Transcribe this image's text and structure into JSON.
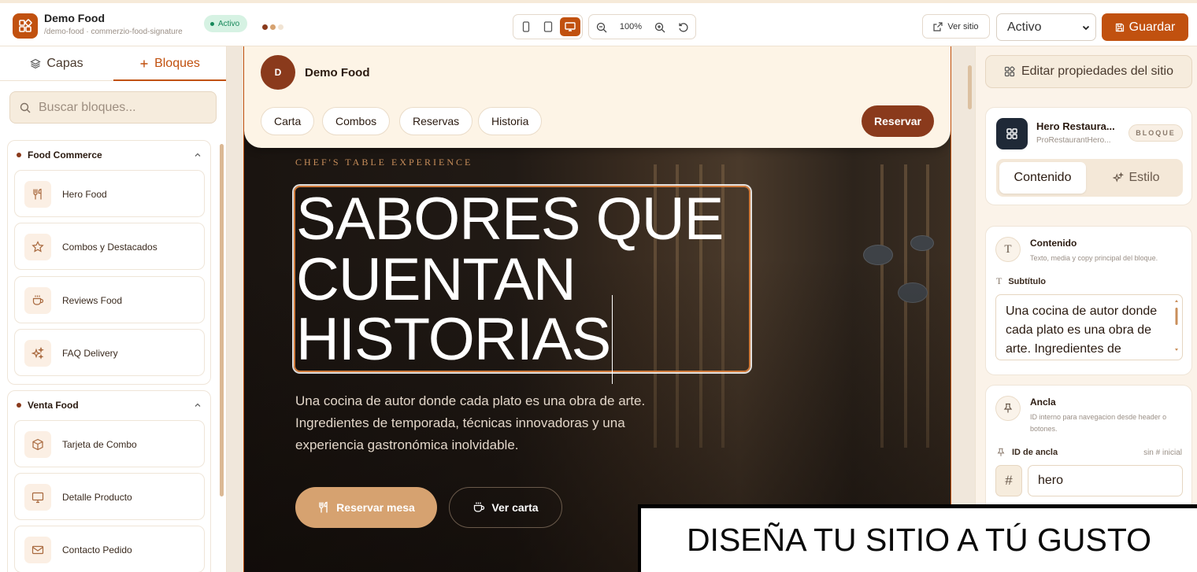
{
  "app": {
    "title": "Demo Food",
    "slug": "/demo-food · commerzio-food-signature",
    "status_badge": "Activo",
    "brand_color": "#c1510f"
  },
  "toolbar": {
    "zoom": "100%",
    "view_site": "Ver sitio",
    "status_value": "Activo",
    "save": "Guardar",
    "device_selected": "desktop"
  },
  "left": {
    "tabs": [
      {
        "label": "Capas",
        "icon": "layers-icon"
      },
      {
        "label": "Bloques",
        "icon": "plus-icon"
      }
    ],
    "active_tab": "Bloques",
    "search_placeholder": "Buscar bloques...",
    "categories": [
      {
        "name": "Food Commerce",
        "items": [
          {
            "label": "Hero Food",
            "icon": "utensils-icon"
          },
          {
            "label": "Combos y Destacados",
            "icon": "star-icon"
          },
          {
            "label": "Reviews Food",
            "icon": "coffee-icon"
          },
          {
            "label": "FAQ Delivery",
            "icon": "sparkles-icon"
          }
        ]
      },
      {
        "name": "Venta Food",
        "items": [
          {
            "label": "Tarjeta de Combo",
            "icon": "box-icon"
          },
          {
            "label": "Detalle Producto",
            "icon": "monitor-icon"
          },
          {
            "label": "Contacto Pedido",
            "icon": "mail-icon"
          }
        ]
      }
    ]
  },
  "preview": {
    "brand_initial": "D",
    "brand_name": "Demo Food",
    "nav": [
      "Carta",
      "Combos",
      "Reservas",
      "Historia"
    ],
    "nav_cta": "Reservar",
    "eyebrow": "CHEF'S TABLE EXPERIENCE",
    "headline": [
      "SABORES QUE",
      "CUENTAN",
      "HISTORIAS"
    ],
    "subtitle": "Una cocina de autor donde cada plato es una obra de arte. Ingredientes de temporada, técnicas innovadoras y una experiencia gastronómica inolvidable.",
    "cta_primary": "Reservar mesa",
    "cta_secondary": "Ver carta"
  },
  "right": {
    "edit_site_props": "Editar propiedades del sitio",
    "block": {
      "name": "Hero Restaura...",
      "type": "ProRestaurantHero...",
      "badge": "BLOQUE"
    },
    "tabs": {
      "content": "Contenido",
      "style": "Estilo",
      "active": "Contenido"
    },
    "content_section": {
      "title": "Contenido",
      "desc": "Texto, media y copy principal del bloque.",
      "field_label": "Subtítulo",
      "field_value": "Una cocina de autor donde cada plato es una obra de arte. Ingredientes de"
    },
    "anchor_section": {
      "title": "Ancla",
      "desc": "ID interno para navegacion desde header o botones.",
      "field_label": "ID de ancla",
      "hint": "sin # inicial",
      "prefix": "#",
      "value": "hero"
    }
  },
  "overlay": {
    "caption": "DISEÑA TU SITIO A TÚ GUSTO"
  }
}
